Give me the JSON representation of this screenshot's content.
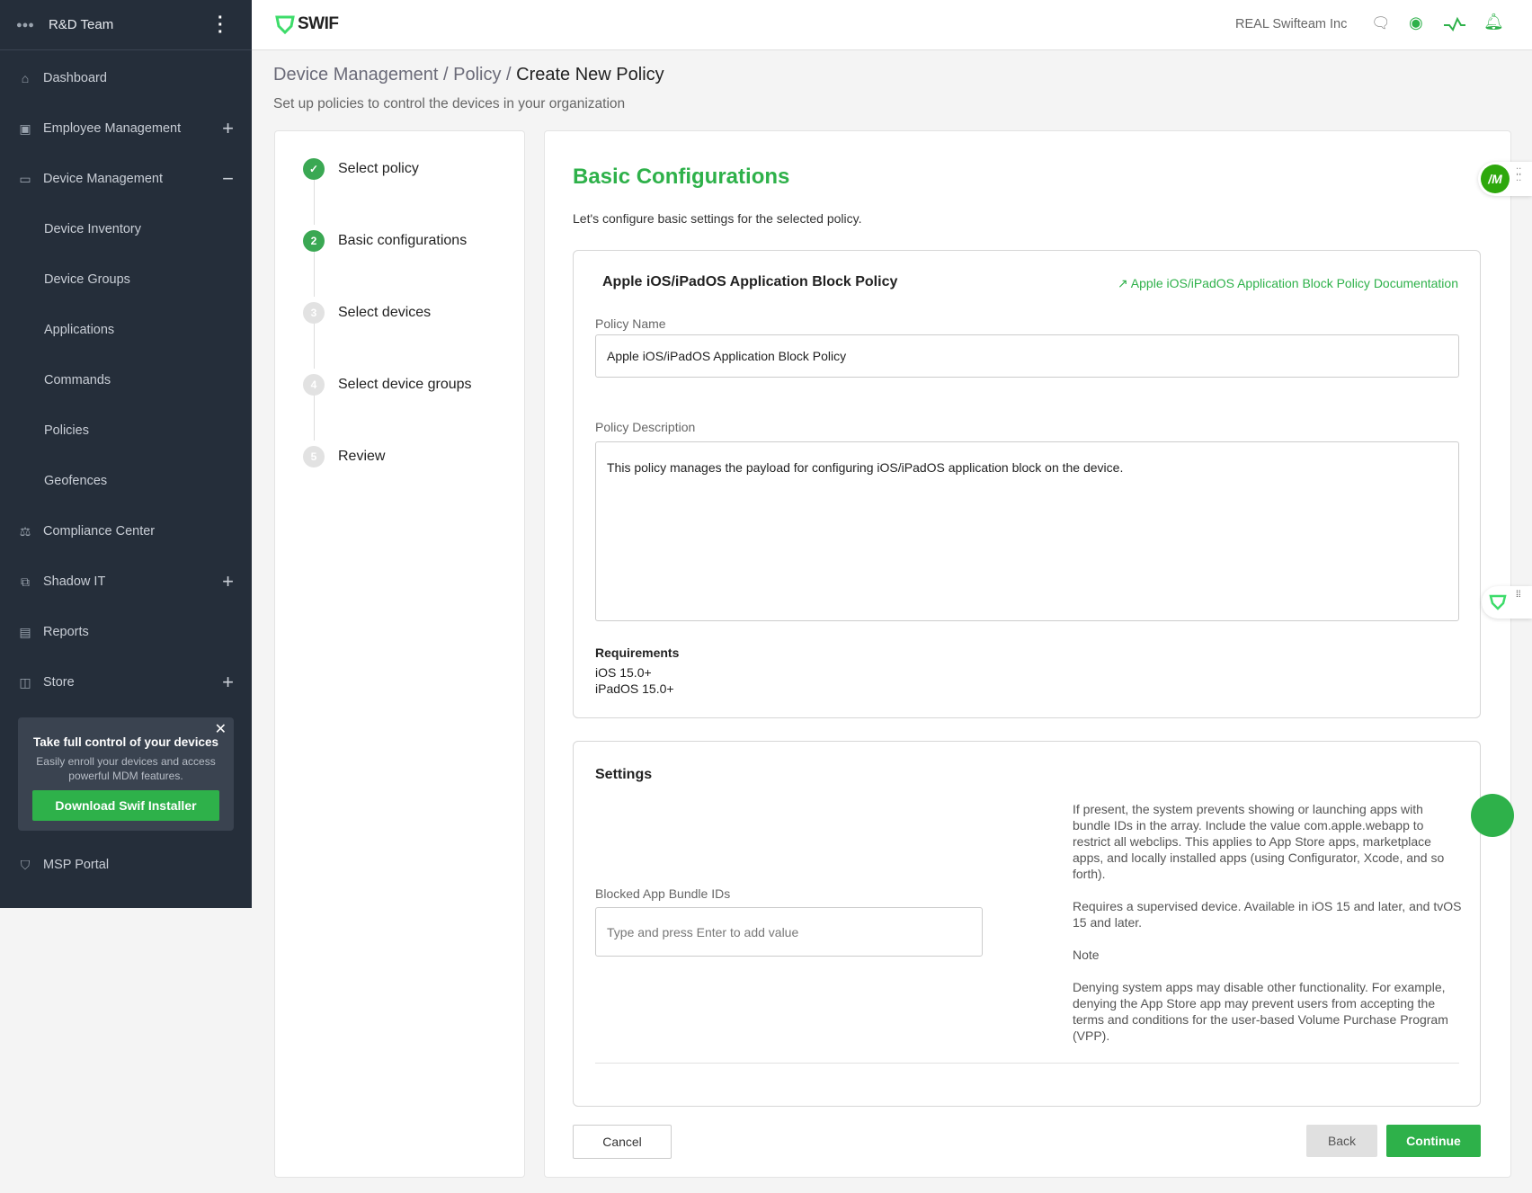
{
  "sidebar": {
    "team": "R&D Team",
    "items": [
      {
        "label": "Dashboard",
        "icon": "home-icon"
      },
      {
        "label": "Employee Management",
        "icon": "employee-icon",
        "expand": "+"
      },
      {
        "label": "Device Management",
        "icon": "device-icon",
        "expand": "−"
      },
      {
        "label": "Device Inventory"
      },
      {
        "label": "Device Groups"
      },
      {
        "label": "Applications"
      },
      {
        "label": "Commands"
      },
      {
        "label": "Policies"
      },
      {
        "label": "Geofences"
      },
      {
        "label": "Compliance Center",
        "icon": "gavel-icon"
      },
      {
        "label": "Shadow IT",
        "icon": "hierarchy-icon",
        "expand": "+"
      },
      {
        "label": "Reports",
        "icon": "report-icon"
      },
      {
        "label": "Store",
        "icon": "bag-icon",
        "expand": "+"
      }
    ],
    "promo": {
      "title": "Take full control of your devices",
      "text": "Easily enroll your devices and access powerful MDM features.",
      "button": "Download Swif Installer"
    },
    "msp": "MSP Portal"
  },
  "header": {
    "logo": "SWIF",
    "org": "REAL Swifteam Inc"
  },
  "page": {
    "breadcrumb": [
      "Device Management",
      "Policy",
      "Create New Policy"
    ],
    "subtitle": "Set up policies to control the devices in your organization"
  },
  "steps": [
    {
      "num": "1",
      "label": "Select policy",
      "state": "done"
    },
    {
      "num": "2",
      "label": "Basic configurations",
      "state": "active"
    },
    {
      "num": "3",
      "label": "Select devices",
      "state": "todo"
    },
    {
      "num": "4",
      "label": "Select device groups",
      "state": "todo"
    },
    {
      "num": "5",
      "label": "Review",
      "state": "todo"
    }
  ],
  "main": {
    "title": "Basic Configurations",
    "intro": "Let's configure basic settings for the selected policy.",
    "policy_title": "Apple iOS/iPadOS Application Block Policy",
    "doc_link": "Apple iOS/iPadOS Application Block Policy Documentation",
    "name_label": "Policy Name",
    "name_value": "Apple iOS/iPadOS Application Block Policy",
    "desc_label": "Policy Description",
    "desc_value": "This policy manages the payload for configuring iOS/iPadOS application block on the device.",
    "req_label": "Requirements",
    "req": [
      "iOS 15.0+",
      "iPadOS 15.0+"
    ],
    "settings_title": "Settings",
    "blocked_label": "Blocked App Bundle IDs",
    "blocked_placeholder": "Type and press Enter to add value",
    "help": [
      "If present, the system prevents showing or launching apps with bundle IDs in the array. Include the value com.apple.webapp to restrict all webclips. This applies to App Store apps, marketplace apps, and locally installed apps (using Configurator, Xcode, and so forth).",
      "Requires a supervised device. Available in iOS 15 and later, and tvOS 15 and later.",
      "Note",
      "Denying system apps may disable other functionality. For example, denying the App Store app may prevent users from accepting the terms and conditions for the user-based Volume Purchase Program (VPP)."
    ],
    "cancel": "Cancel",
    "back": "Back",
    "continue": "Continue"
  },
  "widgets": {
    "avatar": "/M"
  },
  "colors": {
    "accent": "#2eb14a",
    "sidebar": "#252e3a"
  }
}
